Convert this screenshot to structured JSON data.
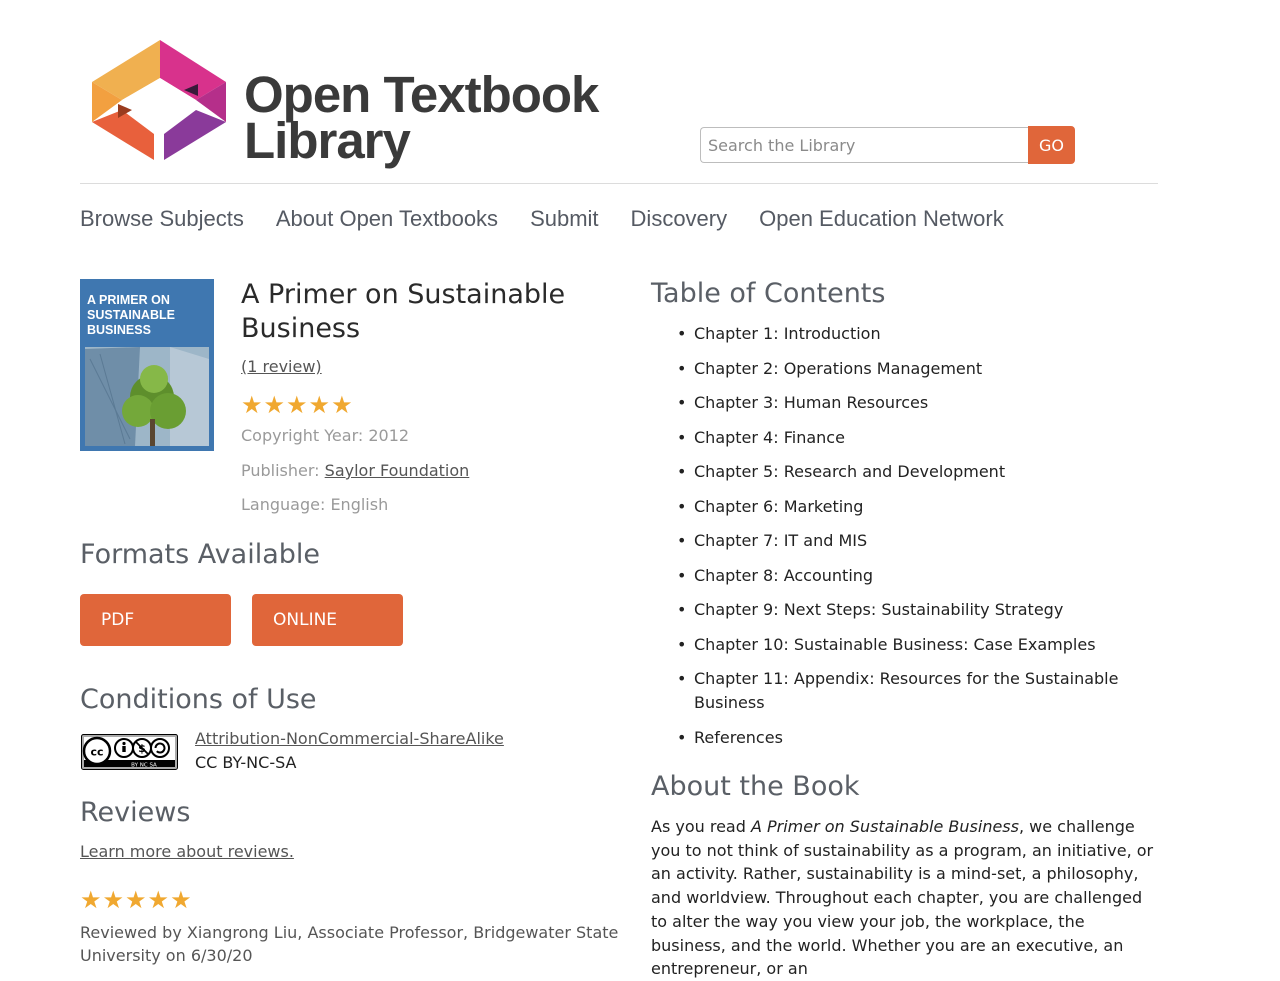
{
  "header": {
    "logo_line1": "Open Textbook",
    "logo_line2": "Library",
    "search_placeholder": "Search the Library",
    "search_button": "GO"
  },
  "nav": [
    "Browse Subjects",
    "About Open Textbooks",
    "Submit",
    "Discovery",
    "Open Education Network"
  ],
  "book": {
    "cover_text": "A PRIMER ON SUSTAINABLE BUSINESS",
    "title": "A Primer on Sustainable Business",
    "review_link": "(1 review)",
    "rating": 5,
    "copyright": "Copyright Year: 2012",
    "publisher_label": "Publisher: ",
    "publisher": "Saylor Foundation",
    "language": "Language: English"
  },
  "formats": {
    "heading": "Formats Available",
    "buttons": [
      "PDF",
      "ONLINE"
    ]
  },
  "conditions": {
    "heading": "Conditions of Use",
    "badge_text": "BY NC SA",
    "license_name": "Attribution-NonCommercial-ShareAlike",
    "license_code": "CC BY-NC-SA"
  },
  "reviews": {
    "heading": "Reviews",
    "learn_more": "Learn more about reviews.",
    "rating": 5,
    "reviewer": "Reviewed by Xiangrong Liu, Associate Professor, Bridgewater State University on 6/30/20"
  },
  "toc": {
    "heading": "Table of Contents",
    "items": [
      "Chapter 1: Introduction",
      "Chapter 2: Operations Management",
      "Chapter 3: Human Resources",
      "Chapter 4: Finance",
      "Chapter 5: Research and Development",
      "Chapter 6: Marketing",
      "Chapter 7: IT and MIS",
      "Chapter 8: Accounting",
      "Chapter 9: Next Steps: Sustainability Strategy",
      "Chapter 10: Sustainable Business: Case Examples",
      "Chapter 11: Appendix: Resources for the Sustainable Business",
      "References"
    ]
  },
  "about": {
    "heading": "About the Book",
    "text_before": "As you read ",
    "text_italic": "A Primer on Sustainable Business",
    "text_after": ", we challenge you to not think of sustainability as a program, an initiative, or an activity. Rather, sustainability is a mind-set, a philosophy, and worldview. Throughout each chapter, you are challenged to alter the way you view your job, the workplace, the business, and the world. Whether you are an executive, an entrepreneur, or an"
  },
  "colors": {
    "accent": "#e0663a",
    "star": "#f0a830",
    "logo_orange": "#f0b050",
    "logo_pink": "#d8328c",
    "logo_purple": "#8a3a9a",
    "logo_red": "#e8603c"
  }
}
